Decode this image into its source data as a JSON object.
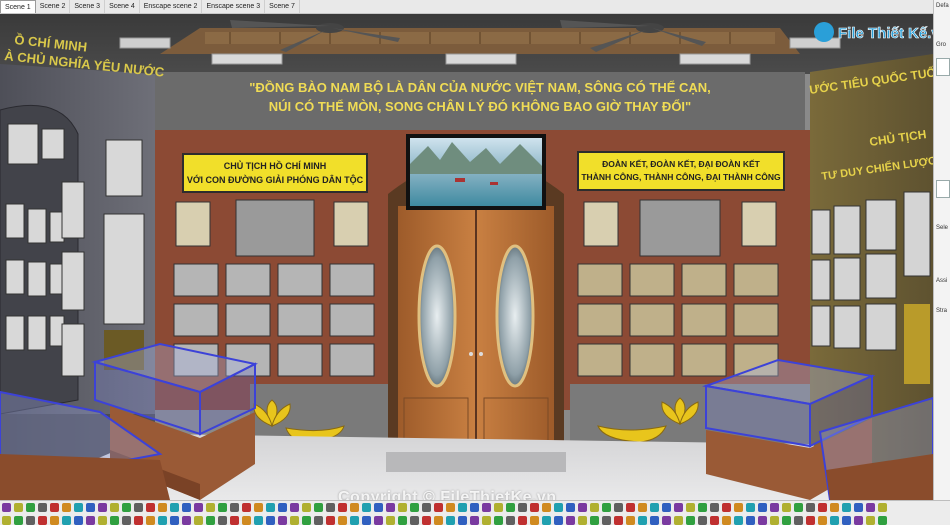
{
  "tabs": [
    {
      "label": "Scene 1",
      "active": true
    },
    {
      "label": "Scene 2",
      "active": false
    },
    {
      "label": "Scene 3",
      "active": false
    },
    {
      "label": "Scene 4",
      "active": false
    },
    {
      "label": "Enscape scene 2",
      "active": false
    },
    {
      "label": "Enscape scene 3",
      "active": false
    },
    {
      "label": "Scene 7",
      "active": false
    }
  ],
  "scene": {
    "quote_line1": "\"ĐỒNG BÀO NAM BỘ LÀ DÂN CỦA NƯỚC VIỆT NAM, SÔNG CÓ THỂ CẠN,",
    "quote_line2": "NÚI CÓ THỂ MÒN, SONG CHÂN LÝ ĐÓ KHÔNG BAO GIỜ THAY ĐỔI\"",
    "left_sign_line1": "CHỦ TỊCH HỒ CHÍ MINH",
    "left_sign_line2": "VỚI CON ĐƯỜNG GIẢI PHÓNG DÂN TỘC",
    "right_sign_line1": "ĐOÀN KẾT, ĐOÀN KẾT, ĐẠI ĐOÀN KẾT",
    "right_sign_line2": "THÀNH CÔNG, THÀNH CÔNG, ĐẠI THÀNH CÔNG",
    "left_wall_line1": "Ồ CHÍ MINH",
    "left_wall_line2": "À CHỦ NGHĨA YÊU NƯỚC",
    "right_wall_line1": "ƯỚC TIÊU QUỐC TUỐN",
    "right_wall_line2": "CHỦ TỊCH",
    "right_wall_line3": "TƯ DUY CHIẾN LƯỢC C"
  },
  "logo": {
    "text": "File Thiết Kế.vn"
  },
  "copyright": "Copyright © FileThietKe.vn",
  "tray": {
    "labels": [
      "Defa",
      "Gro",
      "Sele",
      "Assi",
      "Stra"
    ]
  },
  "colors": {
    "wall_brown": "#8c4a34",
    "sign_yellow": "#f1df2a",
    "door_wood": "#b46f35",
    "banner_gray": "#6b6b6b",
    "quote_yellow": "#f0dc55",
    "vitrine_blue": "#3c42d8"
  }
}
